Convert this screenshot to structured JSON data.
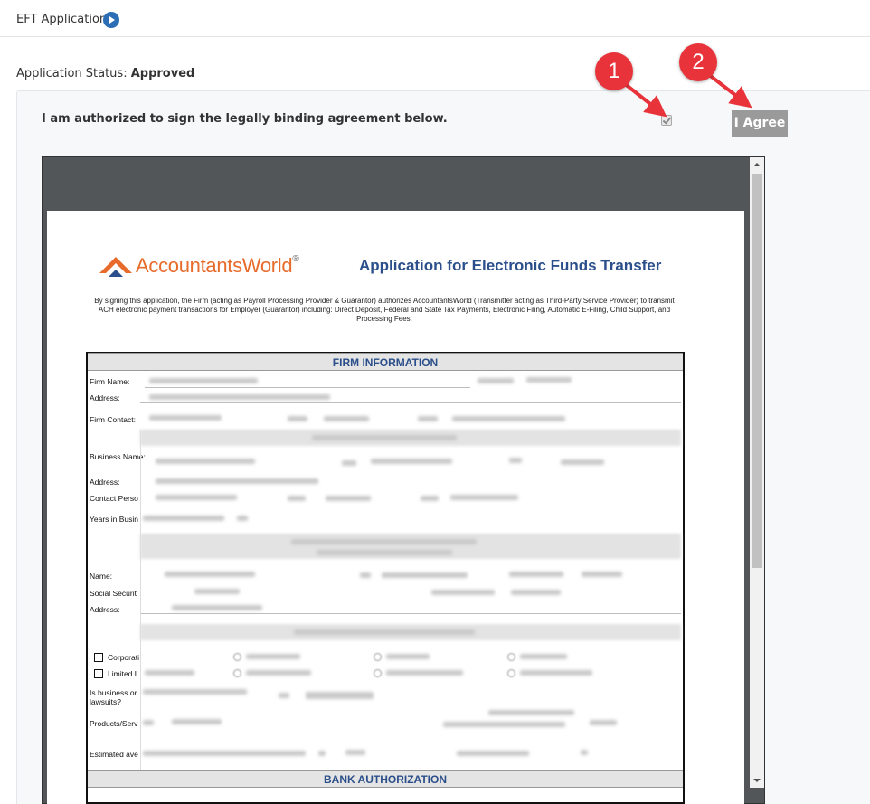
{
  "header": {
    "title": "EFT Application"
  },
  "status": {
    "label": "Application Status:",
    "value": "Approved"
  },
  "authorization": {
    "text": "I am authorized to sign the legally binding agreement below.",
    "checkbox_checked": true,
    "agree_label": "I Agree"
  },
  "callouts": [
    "1",
    "2"
  ],
  "document": {
    "logo_name": "AccountantsWorld",
    "logo_mark": "®",
    "title": "Application for Electronic Funds Transfer",
    "intro": "By signing this application, the Firm (acting as Payroll Processing Provider & Guarantor) authorizes AccountantsWorld (Transmitter acting as Third-Party Service Provider) to transmit ACH electronic payment transactions for Employer (Guarantor) including: Direct Deposit, Federal and State Tax Payments, Electronic Filing, Automatic E-Filing, Child Support, and Processing Fees.",
    "sections": {
      "firm": "FIRM INFORMATION",
      "bank": "BANK AUTHORIZATION"
    },
    "labels": {
      "firm_name": "Firm Name:",
      "address1": "Address:",
      "firm_contact": "Firm Contact:",
      "business_name": "Business Name:",
      "address2": "Address:",
      "contact_person": "Contact Perso",
      "years_in_business": "Years in Busin",
      "name": "Name:",
      "social_security": "Social Securit",
      "address3": "Address:",
      "corporation": "Corporati",
      "limited": "Limited L",
      "is_business": "Is business or lawsuits?",
      "products": "Products/Serv",
      "estimated": "Estimated ave"
    }
  },
  "colors": {
    "accent_blue": "#2c6eb5",
    "callout_red": "#e8333a",
    "title_blue": "#2b4f8a",
    "logo_orange": "#e76b2b"
  }
}
